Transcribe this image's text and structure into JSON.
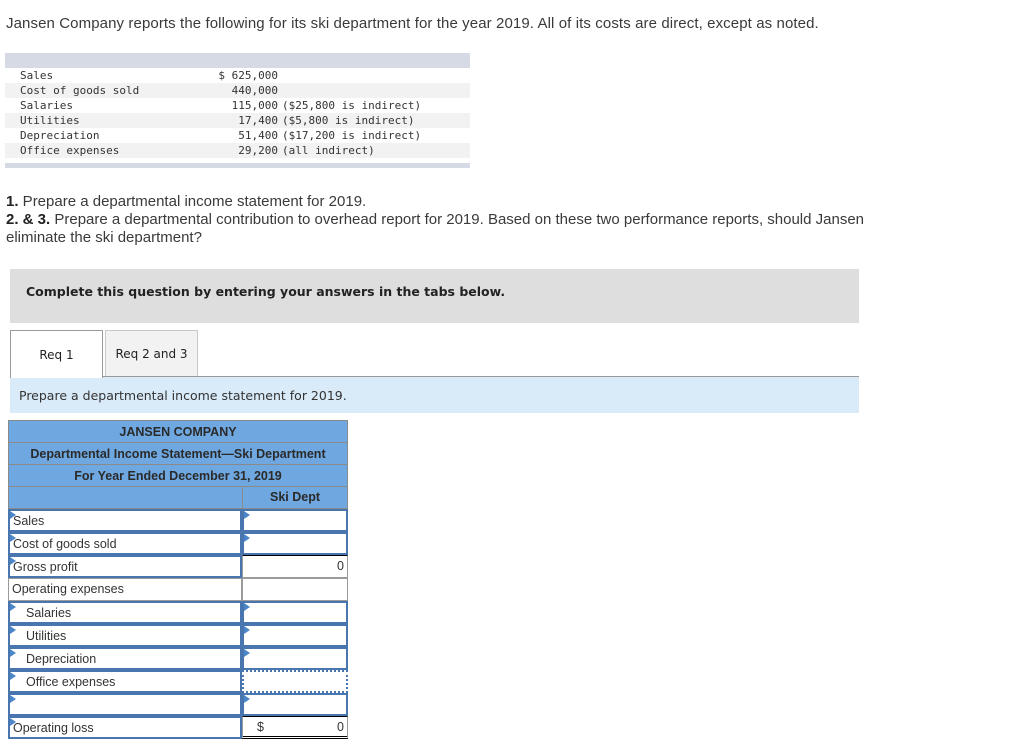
{
  "intro": "Jansen Company reports the following for its ski department for the year 2019. All of its costs are direct, except as noted.",
  "given_data": [
    {
      "label": "Sales",
      "amount": "$ 625,000",
      "note": ""
    },
    {
      "label": "Cost of goods sold",
      "amount": "440,000",
      "note": ""
    },
    {
      "label": "Salaries",
      "amount": "115,000",
      "note": "($25,800 is indirect)"
    },
    {
      "label": "Utilities",
      "amount": "17,400",
      "note": "($5,800 is indirect)"
    },
    {
      "label": "Depreciation",
      "amount": "51,400",
      "note": "($17,200 is indirect)"
    },
    {
      "label": "Office expenses",
      "amount": "29,200",
      "note": "(all indirect)"
    }
  ],
  "questions": {
    "q1_num": "1.",
    "q1_text": " Prepare a departmental income statement for 2019.",
    "q2_num": "2. & 3.",
    "q2_text": " Prepare a departmental contribution to overhead report for 2019. Based on these two performance reports, should Jansen eliminate the ski department?"
  },
  "panel": {
    "text": "Complete this question by entering your answers in the tabs below."
  },
  "tabs": [
    {
      "label": "Req 1",
      "active": true
    },
    {
      "label": "Req 2 and 3",
      "active": false
    }
  ],
  "instruction": "Prepare a departmental income statement for 2019.",
  "statement": {
    "company": "JANSEN COMPANY",
    "title": "Departmental Income Statement—Ski Department",
    "period": "For Year Ended December 31, 2019",
    "column_header": "Ski Dept",
    "rows": [
      {
        "label": "Sales",
        "value": ""
      },
      {
        "label": "Cost of goods sold",
        "value": ""
      },
      {
        "label": "Gross profit",
        "value": "0"
      },
      {
        "label": "Operating expenses",
        "value": ""
      },
      {
        "label": "Salaries",
        "value": ""
      },
      {
        "label": "Utilities",
        "value": ""
      },
      {
        "label": "Depreciation",
        "value": ""
      },
      {
        "label": "Office expenses",
        "value": ""
      },
      {
        "label": "",
        "value": ""
      },
      {
        "label": "Operating loss",
        "currency": "$",
        "value": "0"
      }
    ]
  },
  "colors": {
    "header_blue": "#6fa8e0",
    "input_border": "#4a76b0",
    "instruction_bg": "#d9eaf8",
    "panel_bg": "#dedede"
  }
}
